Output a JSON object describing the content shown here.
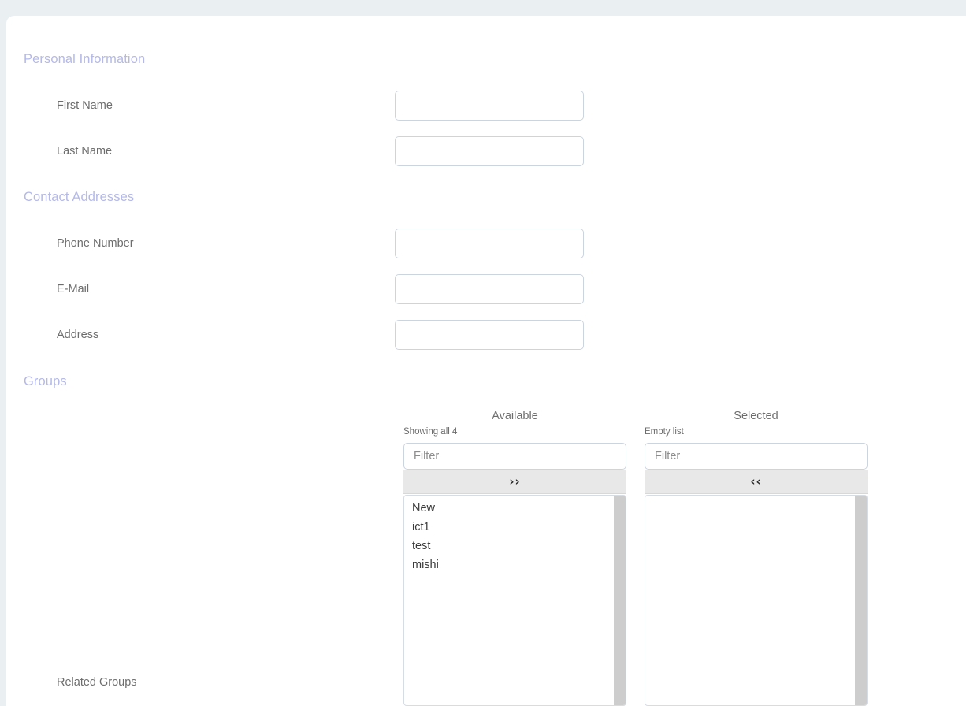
{
  "theme": {
    "page_background": "#eaeff2",
    "card_background": "#ffffff",
    "heading_color": "#b4b9e8",
    "label_color": "#6d6d6d",
    "input_border": "#ccd4de",
    "move_button_background": "#e8e8e8",
    "scrollbar_color": "#cdcdcd"
  },
  "sections": {
    "personal_information": {
      "heading": "Personal Information",
      "fields": [
        {
          "label": "First Name",
          "value": "",
          "placeholder": ""
        },
        {
          "label": "Last Name",
          "value": "",
          "placeholder": ""
        }
      ]
    },
    "contact_addresses": {
      "heading": "Contact Addresses",
      "fields": [
        {
          "label": "Phone Number",
          "value": "",
          "placeholder": ""
        },
        {
          "label": "E-Mail",
          "value": "",
          "placeholder": ""
        },
        {
          "label": "Address",
          "value": "",
          "placeholder": ""
        }
      ]
    },
    "groups": {
      "heading": "Groups",
      "dual_list": {
        "available": {
          "title": "Available",
          "status": "Showing all 4",
          "filter_value": "",
          "filter_placeholder": "Filter",
          "move_button_label": "››",
          "move_button_icon": "chevron-double-right-icon",
          "items": [
            "New",
            "ict1",
            "test",
            "mishi"
          ]
        },
        "selected": {
          "title": "Selected",
          "status": "Empty list",
          "filter_value": "",
          "filter_placeholder": "Filter",
          "move_button_label": "‹‹",
          "move_button_icon": "chevron-double-left-icon",
          "items": []
        }
      },
      "related_groups_label": "Related Groups"
    }
  }
}
